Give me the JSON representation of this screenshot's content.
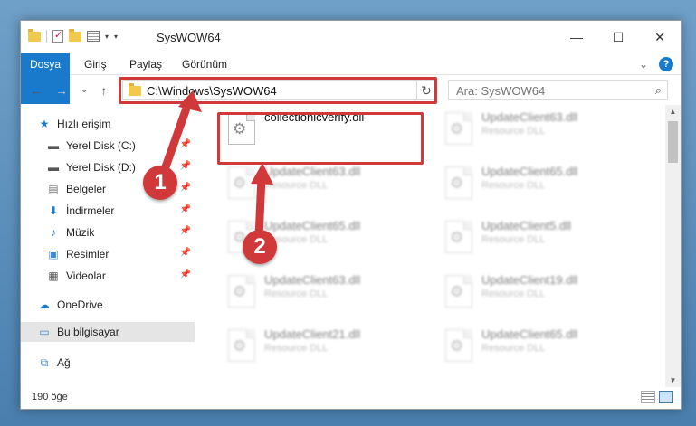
{
  "window": {
    "title": "SysWOW64",
    "controls": {
      "minimize": "—",
      "maximize": "☐",
      "close": "✕"
    }
  },
  "ribbon": {
    "tabs": [
      "Dosya",
      "Giriş",
      "Paylaş",
      "Görünüm"
    ],
    "help": "?",
    "expand": "⌄"
  },
  "navigation": {
    "back": "←",
    "forward": "→",
    "recent": "⌄",
    "up": "↑"
  },
  "address": {
    "path": "C:\\Windows\\SysWOW64",
    "dropdown": "⌄",
    "refresh": "↻"
  },
  "search": {
    "placeholder": "Ara: SysWOW64",
    "icon": "⌕"
  },
  "sidebar": {
    "items": [
      {
        "label": "Hızlı erişim",
        "icon": "star-icon",
        "pinned": false
      },
      {
        "label": "Yerel Disk (C:)",
        "icon": "drive-icon",
        "pinned": true
      },
      {
        "label": "Yerel Disk (D:)",
        "icon": "drive-icon",
        "pinned": true
      },
      {
        "label": "Belgeler",
        "icon": "documents-icon",
        "pinned": true
      },
      {
        "label": "İndirmeler",
        "icon": "download-icon",
        "pinned": true
      },
      {
        "label": "Müzik",
        "icon": "music-icon",
        "pinned": true
      },
      {
        "label": "Resimler",
        "icon": "pictures-icon",
        "pinned": true
      },
      {
        "label": "Videolar",
        "icon": "videos-icon",
        "pinned": true
      },
      {
        "label": "OneDrive",
        "icon": "cloud-icon",
        "pinned": false
      },
      {
        "label": "Bu bilgisayar",
        "icon": "computer-icon",
        "pinned": false,
        "selected": true
      },
      {
        "label": "Ağ",
        "icon": "network-icon",
        "pinned": false
      }
    ]
  },
  "files": [
    {
      "name": "collectionicverify.dll",
      "type": "",
      "highlighted": true
    },
    {
      "name": "UpdateClient63.dll",
      "type": "Resource DLL"
    },
    {
      "name": "UpdateClient63.dll",
      "type": "Resource DLL"
    },
    {
      "name": "UpdateClient65.dll",
      "type": "Resource DLL"
    },
    {
      "name": "UpdateClient65.dll",
      "type": "Resource DLL"
    },
    {
      "name": "UpdateClient5.dll",
      "type": "Resource DLL"
    },
    {
      "name": "UpdateClient63.dll",
      "type": "Resource DLL"
    },
    {
      "name": "UpdateClient19.dll",
      "type": "Resource DLL"
    },
    {
      "name": "UpdateClient21.dll",
      "type": "Resource DLL"
    },
    {
      "name": "UpdateClient65.dll",
      "type": "Resource DLL"
    }
  ],
  "status": {
    "count": "190 öğe"
  },
  "callouts": [
    {
      "label": "1"
    },
    {
      "label": "2"
    }
  ],
  "colors": {
    "accent": "#1979ca",
    "highlight": "#d0383a"
  }
}
